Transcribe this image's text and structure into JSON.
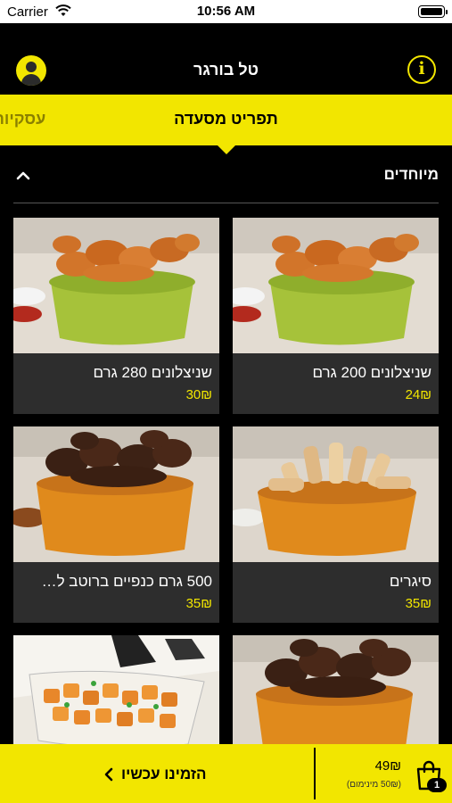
{
  "status_bar": {
    "carrier": "Carrier",
    "time": "10:56 AM"
  },
  "header": {
    "title": "טל בורגר"
  },
  "tabs": {
    "active": "תפריט מסעדה",
    "other": "עסקיות"
  },
  "section": {
    "title": "מיוחדים"
  },
  "products": [
    {
      "name": "שניצלונים 200 גרם",
      "price": "24₪"
    },
    {
      "name": "שניצלונים 280 גרם",
      "price": "30₪"
    },
    {
      "name": "סיגרים",
      "price": "35₪"
    },
    {
      "name": "500 גרם כנפיים ברוטב ל…",
      "price": "35₪"
    },
    {
      "name": "",
      "price": ""
    },
    {
      "name": "",
      "price": ""
    }
  ],
  "bottom_bar": {
    "order_label": "הזמינו עכשיו",
    "total": "49₪",
    "minimum_note": "(50₪ מינימום)",
    "cart_count": "1"
  },
  "colors": {
    "accent": "#f2e600",
    "background": "#000000",
    "card": "#2d2d2d"
  }
}
